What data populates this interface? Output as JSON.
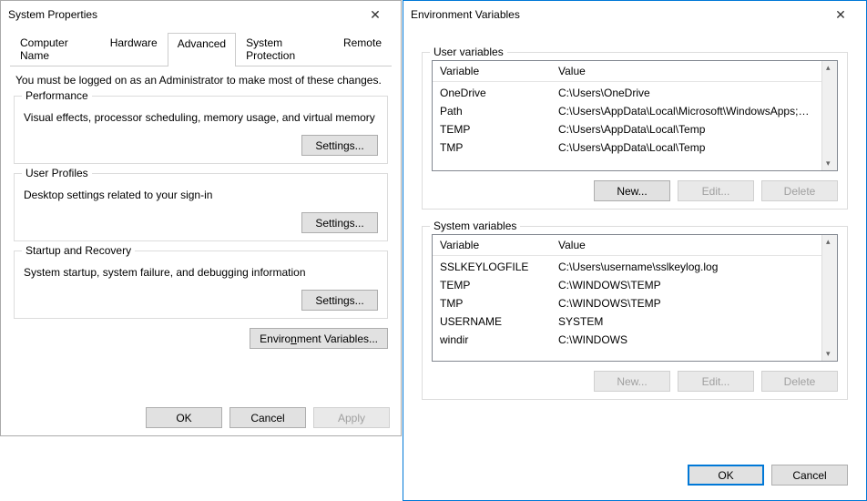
{
  "sysProps": {
    "title": "System Properties",
    "tabs": [
      "Computer Name",
      "Hardware",
      "Advanced",
      "System Protection",
      "Remote"
    ],
    "activeTab": 2,
    "intro": "You must be logged on as an Administrator to make most of these changes.",
    "perf": {
      "legend": "Performance",
      "desc": "Visual effects, processor scheduling, memory usage, and virtual memory",
      "btn": "Settings..."
    },
    "profiles": {
      "legend": "User Profiles",
      "desc": "Desktop settings related to your sign-in",
      "btn": "Settings..."
    },
    "startup": {
      "legend": "Startup and Recovery",
      "desc": "System startup, system failure, and debugging information",
      "btn": "Settings..."
    },
    "envBtn": "Environment Variables...",
    "ok": "OK",
    "cancel": "Cancel",
    "apply": "Apply"
  },
  "envDlg": {
    "title": "Environment Variables",
    "userGroup": "User variables",
    "sysGroup": "System variables",
    "colVar": "Variable",
    "colVal": "Value",
    "userVars": [
      {
        "name": "OneDrive",
        "value": "C:\\Users\\OneDrive"
      },
      {
        "name": "Path",
        "value": "C:\\Users\\AppData\\Local\\Microsoft\\WindowsApps;C:\\Progra..."
      },
      {
        "name": "TEMP",
        "value": "C:\\Users\\AppData\\Local\\Temp"
      },
      {
        "name": "TMP",
        "value": "C:\\Users\\AppData\\Local\\Temp"
      }
    ],
    "sysVars": [
      {
        "name": "SSLKEYLOGFILE",
        "value": "C:\\Users\\username\\sslkeylog.log"
      },
      {
        "name": "TEMP",
        "value": "C:\\WINDOWS\\TEMP"
      },
      {
        "name": "TMP",
        "value": "C:\\WINDOWS\\TEMP"
      },
      {
        "name": "USERNAME",
        "value": "SYSTEM"
      },
      {
        "name": "windir",
        "value": "C:\\WINDOWS"
      }
    ],
    "newBtn": "New...",
    "editBtn": "Edit...",
    "delBtn": "Delete",
    "ok": "OK",
    "cancel": "Cancel"
  }
}
